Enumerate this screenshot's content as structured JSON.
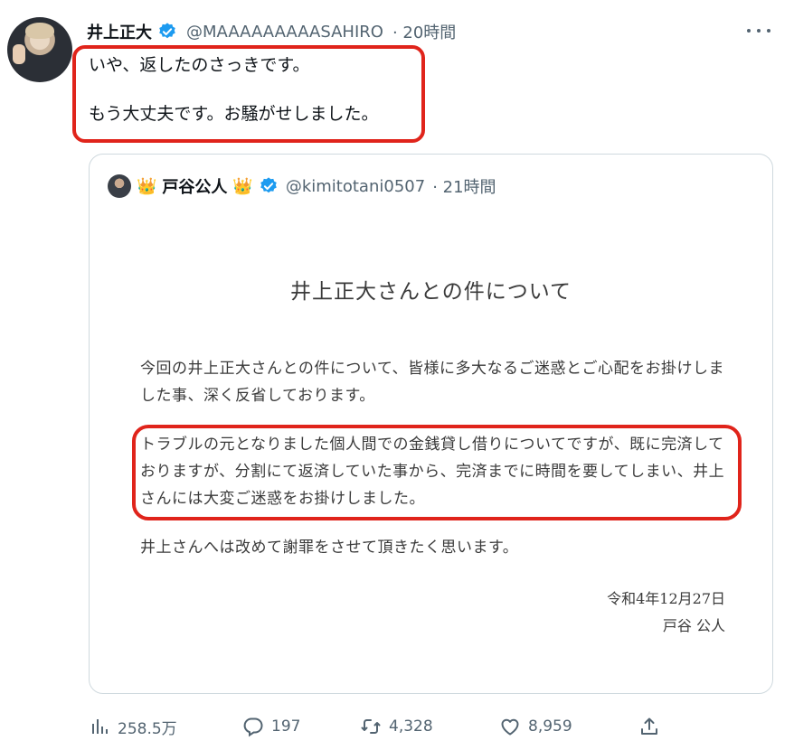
{
  "tweet": {
    "author_name": "井上正大",
    "author_handle": "@MAAAAAAAAASAHIRO",
    "time": "· 20時間",
    "text_line1": "いや、返したのさっきです。",
    "text_line2": "もう大丈夫です。お騒がせしました。"
  },
  "quote": {
    "crown": "👑",
    "author_name": "戸谷公人",
    "author_handle": "@kimitotani0507",
    "time": "· 21時間",
    "document": {
      "title": "井上正大さんとの件について",
      "paragraph1": "今回の井上正大さんとの件について、皆様に多大なるご迷惑とご心配をお掛けしました事、深く反省しております。",
      "paragraph2": "トラブルの元となりました個人間での金銭貸し借りについてですが、既に完済しておりますが、分割にて返済していた事から、完済までに時間を要してしまい、井上さんには大変ご迷惑をお掛けしました。",
      "paragraph3": "井上さんへは改めて謝罪をさせて頂きたく思います。",
      "date": "令和4年12月27日",
      "signer": "戸谷 公人"
    }
  },
  "actions": {
    "views": "258.5万",
    "replies": "197",
    "retweets": "4,328",
    "likes": "8,959"
  },
  "icons": {
    "verified": "verified-badge-icon",
    "more": "more-options-icon",
    "views": "bar-chart-icon",
    "reply": "speech-bubble-icon",
    "retweet": "retweet-arrows-icon",
    "like": "heart-icon",
    "share": "share-upload-icon"
  },
  "colors": {
    "verified": "#1d9bf0",
    "annotation": "#e0241b",
    "secondary_text": "#536471",
    "border": "#cfd9de"
  }
}
